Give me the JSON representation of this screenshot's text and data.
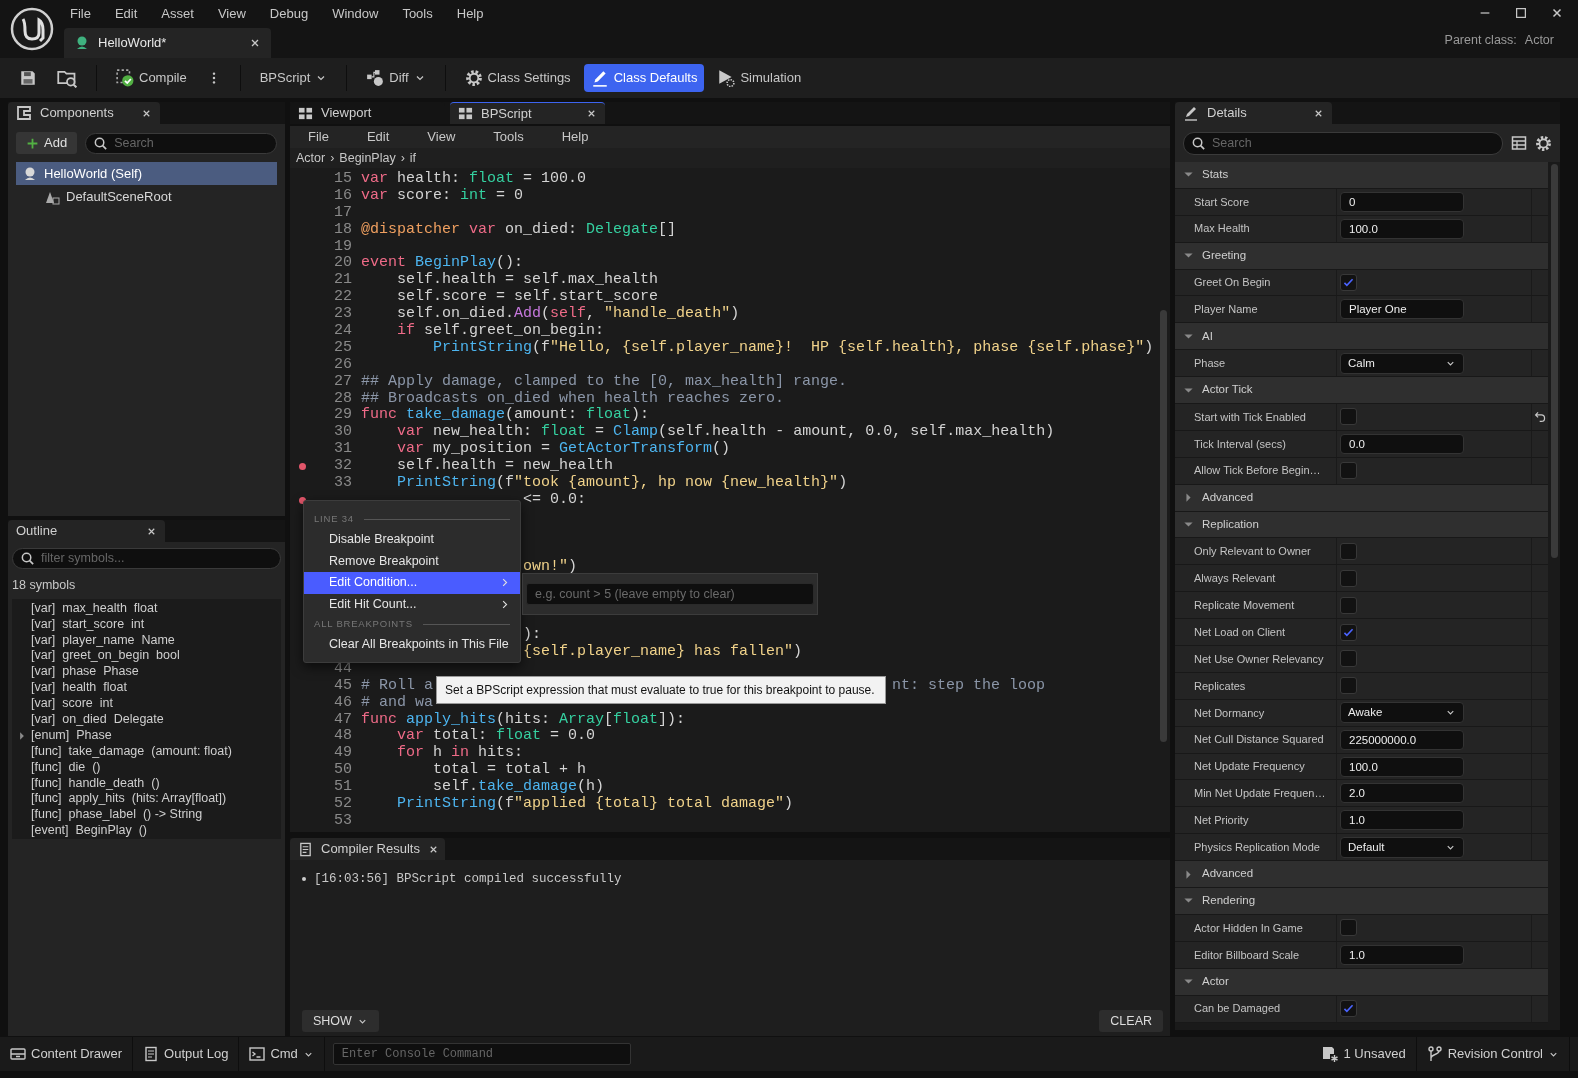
{
  "app": {
    "menu": [
      "File",
      "Edit",
      "Asset",
      "View",
      "Debug",
      "Window",
      "Tools",
      "Help"
    ],
    "asset_tab": {
      "label": "HelloWorld*",
      "selected": true
    },
    "parent_class": {
      "label": "Parent class:",
      "value": "Actor"
    }
  },
  "toolbar": [
    {
      "kind": "button",
      "label": "Compile",
      "selected": false
    },
    {
      "kind": "dropdown",
      "label": "BPScript",
      "selected": false
    },
    {
      "kind": "dropdown",
      "label": "Diff",
      "selected": false
    },
    {
      "kind": "button",
      "label": "Class Settings",
      "selected": false
    },
    {
      "kind": "button",
      "label": "Class Defaults",
      "selected": true
    },
    {
      "kind": "button",
      "label": "Simulation",
      "selected": false
    }
  ],
  "components": {
    "title": "Components",
    "add_label": "Add",
    "search_placeholder": "Search",
    "tree": [
      {
        "label": "HelloWorld (Self)",
        "selected": true,
        "children": [
          {
            "label": "DefaultSceneRoot",
            "selected": false
          }
        ]
      }
    ]
  },
  "outline": {
    "title": "Outline",
    "filter_placeholder": "filter symbols...",
    "count": "18 symbols",
    "items": [
      {
        "text": "[var]  max_health  float",
        "expandable": false
      },
      {
        "text": "[var]  start_score  int",
        "expandable": false
      },
      {
        "text": "[var]  player_name  Name",
        "expandable": false
      },
      {
        "text": "[var]  greet_on_begin  bool",
        "expandable": false
      },
      {
        "text": "[var]  phase  Phase",
        "expandable": false
      },
      {
        "text": "[var]  health  float",
        "expandable": false
      },
      {
        "text": "[var]  score  int",
        "expandable": false
      },
      {
        "text": "[var]  on_died  Delegate",
        "expandable": false
      },
      {
        "text": "[enum]  Phase",
        "expandable": true
      },
      {
        "text": "[func]  take_damage  (amount: float)",
        "expandable": false
      },
      {
        "text": "[func]  die  ()",
        "expandable": false
      },
      {
        "text": "[func]  handle_death  ()",
        "expandable": false
      },
      {
        "text": "[func]  apply_hits  (hits: Array[float])",
        "expandable": false
      },
      {
        "text": "[func]  phase_label  () -> String",
        "expandable": false
      },
      {
        "text": "[event]  BeginPlay  ()",
        "expandable": false
      }
    ]
  },
  "editor": {
    "tabs": [
      {
        "label": "Viewport",
        "selected": false
      },
      {
        "label": "BPScript",
        "selected": true
      }
    ],
    "menu": [
      "File",
      "Edit",
      "View",
      "Tools",
      "Help"
    ],
    "breadcrumb": [
      "Actor",
      "BeginPlay",
      "if"
    ],
    "separator": "›",
    "lines": [
      {
        "number": "15",
        "breakpoint": false,
        "tokens": [
          {
            "kind": "keyword",
            "text": "var"
          },
          {
            "kind": "plain",
            "text": " health: "
          },
          {
            "kind": "type",
            "text": "float"
          },
          {
            "kind": "plain",
            "text": " = 100.0"
          }
        ]
      },
      {
        "number": "16",
        "breakpoint": false,
        "tokens": [
          {
            "kind": "keyword",
            "text": "var"
          },
          {
            "kind": "plain",
            "text": " score: "
          },
          {
            "kind": "type",
            "text": "int"
          },
          {
            "kind": "plain",
            "text": " = 0"
          }
        ]
      },
      {
        "number": "17",
        "breakpoint": false
      },
      {
        "number": "18",
        "breakpoint": false,
        "tokens": [
          {
            "kind": "decorator",
            "text": "@dispatcher "
          },
          {
            "kind": "keyword",
            "text": "var"
          },
          {
            "kind": "plain",
            "text": " on_died: "
          },
          {
            "kind": "type",
            "text": "Delegate"
          },
          {
            "kind": "plain",
            "text": "[]"
          }
        ]
      },
      {
        "number": "19",
        "breakpoint": false
      },
      {
        "number": "20",
        "breakpoint": false,
        "tokens": [
          {
            "kind": "keyword",
            "text": "event "
          },
          {
            "kind": "function",
            "text": "BeginPlay"
          },
          {
            "kind": "plain",
            "text": "():"
          }
        ]
      },
      {
        "number": "21",
        "breakpoint": false,
        "tokens": [
          {
            "kind": "plain",
            "text": "    self.health = self.max_health"
          }
        ]
      },
      {
        "number": "22",
        "breakpoint": false,
        "tokens": [
          {
            "kind": "plain",
            "text": "    self.score = self.start_score"
          }
        ]
      },
      {
        "number": "23",
        "breakpoint": false,
        "tokens": [
          {
            "kind": "plain",
            "text": "    self.on_died."
          },
          {
            "kind": "method",
            "text": "Add"
          },
          {
            "kind": "plain",
            "text": "("
          },
          {
            "kind": "keyword",
            "text": "self"
          },
          {
            "kind": "plain",
            "text": ", "
          },
          {
            "kind": "string",
            "text": "\"handle_death\""
          },
          {
            "kind": "plain",
            "text": ")"
          }
        ]
      },
      {
        "number": "24",
        "breakpoint": false,
        "tokens": [
          {
            "kind": "keyword",
            "text": "    if"
          },
          {
            "kind": "plain",
            "text": " self.greet_on_begin:"
          }
        ]
      },
      {
        "number": "25",
        "breakpoint": false,
        "tokens": [
          {
            "kind": "function",
            "text": "        PrintString"
          },
          {
            "kind": "plain",
            "text": "(f"
          },
          {
            "kind": "string",
            "text": "\"Hello, {self.player_name}!  HP {self.health}, phase {self.phase}\""
          },
          {
            "kind": "plain",
            "text": ")"
          }
        ]
      },
      {
        "number": "26",
        "breakpoint": false
      },
      {
        "number": "27",
        "breakpoint": false,
        "tokens": [
          {
            "kind": "comment",
            "text": "## Apply damage, clamped to the [0, max_health] range."
          }
        ]
      },
      {
        "number": "28",
        "breakpoint": false,
        "tokens": [
          {
            "kind": "comment",
            "text": "## Broadcasts on_died when health reaches zero."
          }
        ]
      },
      {
        "number": "29",
        "breakpoint": false,
        "tokens": [
          {
            "kind": "keyword",
            "text": "func "
          },
          {
            "kind": "function",
            "text": "take_damage"
          },
          {
            "kind": "plain",
            "text": "(amount: "
          },
          {
            "kind": "type",
            "text": "float"
          },
          {
            "kind": "plain",
            "text": "):"
          }
        ]
      },
      {
        "number": "30",
        "breakpoint": false,
        "tokens": [
          {
            "kind": "keyword",
            "text": "    var"
          },
          {
            "kind": "plain",
            "text": " new_health: "
          },
          {
            "kind": "type",
            "text": "float"
          },
          {
            "kind": "plain",
            "text": " = "
          },
          {
            "kind": "function",
            "text": "Clamp"
          },
          {
            "kind": "plain",
            "text": "(self.health - amount, 0.0, self.max_health)"
          }
        ]
      },
      {
        "number": "31",
        "breakpoint": false,
        "tokens": [
          {
            "kind": "keyword",
            "text": "    var"
          },
          {
            "kind": "plain",
            "text": " my_position = "
          },
          {
            "kind": "function",
            "text": "GetActorTransform"
          },
          {
            "kind": "plain",
            "text": "()"
          }
        ]
      },
      {
        "number": "32",
        "breakpoint": true,
        "tokens": [
          {
            "kind": "plain",
            "text": "    self.health = new_health"
          }
        ]
      },
      {
        "number": "33",
        "breakpoint": false,
        "tokens": [
          {
            "kind": "function",
            "text": "    PrintString"
          },
          {
            "kind": "plain",
            "text": "(f"
          },
          {
            "kind": "string",
            "text": "\"took {amount}, hp now {new_health}\""
          },
          {
            "kind": "plain",
            "text": ")"
          }
        ]
      },
      {
        "breakpoint": true,
        "tokens": [
          {
            "kind": "plain",
            "text": "                  <= 0.0:"
          }
        ]
      },
      {
        "breakpoint": false
      },
      {
        "breakpoint": false
      },
      {
        "breakpoint": false
      },
      {
        "breakpoint": false,
        "tokens": [
          {
            "kind": "string",
            "text": "                  own!\""
          },
          {
            "kind": "plain",
            "text": ")"
          }
        ]
      },
      {
        "breakpoint": false
      },
      {
        "breakpoint": false
      },
      {
        "breakpoint": false
      },
      {
        "breakpoint": false,
        "tokens": [
          {
            "kind": "plain",
            "text": "                  ):"
          }
        ]
      },
      {
        "breakpoint": false,
        "tokens": [
          {
            "kind": "string",
            "text": "                  {self.player_name} has fallen\""
          },
          {
            "kind": "plain",
            "text": ")"
          }
        ]
      },
      {
        "number": "44",
        "breakpoint": false
      },
      {
        "number": "45",
        "breakpoint": false,
        "tokens": [
          {
            "kind": "comment",
            "text": "# Roll a"
          },
          {
            "kind": "comment",
            "text": "                                                   nt: step the loop"
          }
        ]
      },
      {
        "number": "46",
        "breakpoint": false,
        "tokens": [
          {
            "kind": "comment",
            "text": "# and wa"
          }
        ]
      },
      {
        "number": "47",
        "breakpoint": false,
        "tokens": [
          {
            "kind": "keyword",
            "text": "func "
          },
          {
            "kind": "function",
            "text": "apply_hits"
          },
          {
            "kind": "plain",
            "text": "(hits: "
          },
          {
            "kind": "type",
            "text": "Array"
          },
          {
            "kind": "plain",
            "text": "["
          },
          {
            "kind": "type",
            "text": "float"
          },
          {
            "kind": "plain",
            "text": "]):"
          }
        ]
      },
      {
        "number": "48",
        "breakpoint": false,
        "tokens": [
          {
            "kind": "keyword",
            "text": "    var"
          },
          {
            "kind": "plain",
            "text": " total: "
          },
          {
            "kind": "type",
            "text": "float"
          },
          {
            "kind": "plain",
            "text": " = 0.0"
          }
        ]
      },
      {
        "number": "49",
        "breakpoint": false,
        "tokens": [
          {
            "kind": "keyword",
            "text": "    for"
          },
          {
            "kind": "plain",
            "text": " h "
          },
          {
            "kind": "keyword",
            "text": "in"
          },
          {
            "kind": "plain",
            "text": " hits:"
          }
        ]
      },
      {
        "number": "50",
        "breakpoint": false,
        "tokens": [
          {
            "kind": "plain",
            "text": "        total = total + h"
          }
        ]
      },
      {
        "number": "51",
        "breakpoint": false,
        "tokens": [
          {
            "kind": "plain",
            "text": "        self."
          },
          {
            "kind": "function",
            "text": "take_damage"
          },
          {
            "kind": "plain",
            "text": "(h)"
          }
        ]
      },
      {
        "number": "52",
        "breakpoint": false,
        "tokens": [
          {
            "kind": "function",
            "text": "    PrintString"
          },
          {
            "kind": "plain",
            "text": "(f"
          },
          {
            "kind": "string",
            "text": "\"applied {total} total damage\""
          },
          {
            "kind": "plain",
            "text": ")"
          }
        ]
      },
      {
        "number": "53",
        "breakpoint": false
      }
    ]
  },
  "context_menu": {
    "items": [
      {
        "kind": "header",
        "label": "LINE 34"
      },
      {
        "kind": "item",
        "label": "Disable Breakpoint",
        "selected": false,
        "submenu": false
      },
      {
        "kind": "item",
        "label": "Remove Breakpoint",
        "selected": false,
        "submenu": false
      },
      {
        "kind": "item",
        "label": "Edit Condition...",
        "selected": true,
        "submenu": true
      },
      {
        "kind": "item",
        "label": "Edit Hit Count...",
        "selected": false,
        "submenu": true
      },
      {
        "kind": "header",
        "label": "ALL BREAKPOINTS"
      },
      {
        "kind": "item",
        "label": "Clear All Breakpoints in This File",
        "selected": false,
        "submenu": false
      }
    ]
  },
  "condition_popup": {
    "placeholder": "e.g. count > 5 (leave empty to clear)"
  },
  "tooltip": "Set a BPScript expression that must evaluate to true for this breakpoint to pause.",
  "compiler": {
    "title": "Compiler Results",
    "messages": [
      "[16:03:56] BPScript compiled successfully"
    ],
    "show_label": "SHOW",
    "clear_label": "CLEAR"
  },
  "details": {
    "title": "Details",
    "search_placeholder": "Search",
    "rows": [
      {
        "kind": "section",
        "label": "Stats",
        "expanded": true
      },
      {
        "kind": "text",
        "label": "Start Score",
        "value": "0",
        "modified": false
      },
      {
        "kind": "text",
        "label": "Max Health",
        "value": "100.0",
        "modified": false
      },
      {
        "kind": "section",
        "label": "Greeting",
        "expanded": true
      },
      {
        "kind": "check",
        "label": "Greet On Begin",
        "checked": true,
        "modified": false
      },
      {
        "kind": "text",
        "label": "Player Name",
        "value": "Player One",
        "modified": false
      },
      {
        "kind": "section",
        "label": "AI",
        "expanded": true
      },
      {
        "kind": "select",
        "label": "Phase",
        "value": "Calm",
        "modified": false
      },
      {
        "kind": "section",
        "label": "Actor Tick",
        "expanded": true
      },
      {
        "kind": "check",
        "label": "Start with Tick Enabled",
        "checked": false,
        "modified": true
      },
      {
        "kind": "text",
        "label": "Tick Interval (secs)",
        "value": "0.0",
        "modified": false
      },
      {
        "kind": "check",
        "label": "Allow Tick Before Begin…",
        "checked": false,
        "modified": false
      },
      {
        "kind": "section",
        "label": "Advanced",
        "expanded": false
      },
      {
        "kind": "section",
        "label": "Replication",
        "expanded": true
      },
      {
        "kind": "check",
        "label": "Only Relevant to Owner",
        "checked": false,
        "modified": false
      },
      {
        "kind": "check",
        "label": "Always Relevant",
        "checked": false,
        "modified": false
      },
      {
        "kind": "check",
        "label": "Replicate Movement",
        "checked": false,
        "modified": false
      },
      {
        "kind": "check",
        "label": "Net Load on Client",
        "checked": true,
        "modified": false
      },
      {
        "kind": "check",
        "label": "Net Use Owner Relevancy",
        "checked": false,
        "modified": false
      },
      {
        "kind": "check",
        "label": "Replicates",
        "checked": false,
        "modified": false
      },
      {
        "kind": "select",
        "label": "Net Dormancy",
        "value": "Awake",
        "modified": false
      },
      {
        "kind": "text",
        "label": "Net Cull Distance Squared",
        "value": "225000000.0",
        "modified": false
      },
      {
        "kind": "text",
        "label": "Net Update Frequency",
        "value": "100.0",
        "modified": false
      },
      {
        "kind": "text",
        "label": "Min Net Update Frequen…",
        "value": "2.0",
        "modified": false
      },
      {
        "kind": "text",
        "label": "Net Priority",
        "value": "1.0",
        "modified": false
      },
      {
        "kind": "select",
        "label": "Physics Replication Mode",
        "value": "Default",
        "modified": false
      },
      {
        "kind": "section",
        "label": "Advanced",
        "expanded": false
      },
      {
        "kind": "section",
        "label": "Rendering",
        "expanded": true
      },
      {
        "kind": "check",
        "label": "Actor Hidden In Game",
        "checked": false,
        "modified": false
      },
      {
        "kind": "text",
        "label": "Editor Billboard Scale",
        "value": "1.0",
        "modified": false
      },
      {
        "kind": "section",
        "label": "Actor",
        "expanded": true
      },
      {
        "kind": "check",
        "label": "Can be Damaged",
        "checked": true,
        "modified": false
      }
    ]
  },
  "status_bar": {
    "left": [
      {
        "kind": "button",
        "label": "Content Drawer"
      },
      {
        "kind": "button",
        "label": "Output Log"
      },
      {
        "kind": "dropdown",
        "label": "Cmd"
      },
      {
        "kind": "input",
        "placeholder": "Enter Console Command"
      }
    ],
    "right": [
      {
        "kind": "button",
        "label": "1 Unsaved"
      },
      {
        "kind": "dropdown",
        "label": "Revision Control"
      }
    ]
  }
}
